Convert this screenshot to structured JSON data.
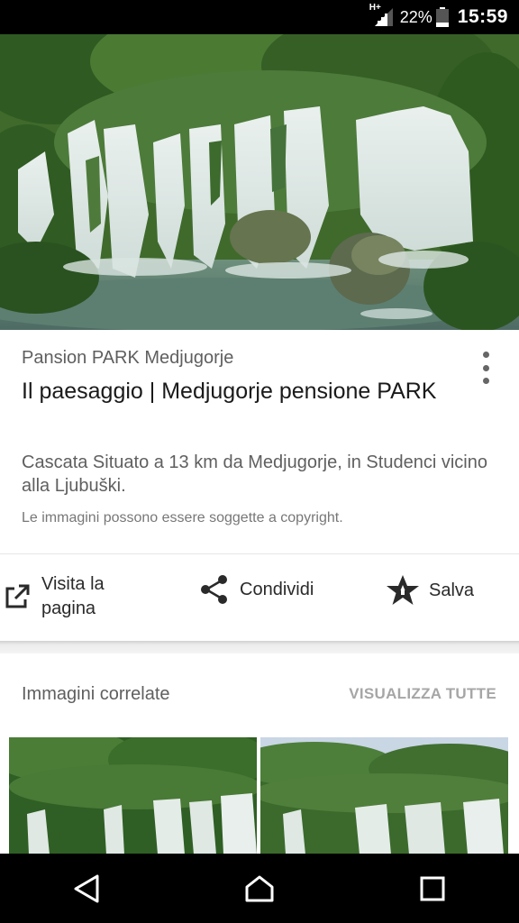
{
  "status_bar": {
    "network": "H+",
    "battery_percent": "22%",
    "battery_level": 0.22,
    "time": "15:59",
    "icons": [
      "signal-icon",
      "battery-icon"
    ]
  },
  "result": {
    "source": "Pansion PARK Medjugorje",
    "title": "Il paesaggio | Medjugorje pensione PARK",
    "description": "Cascata Situato a 13 km da Medjugorje, in Studenci vicino alla Ljubuški.",
    "copyright_note": "Le immagini possono essere soggette a copyright."
  },
  "actions": {
    "visit_line1": "Visita la",
    "visit_line2": "pagina",
    "share": "Condividi",
    "save": "Salva"
  },
  "related": {
    "title": "Immagini correlate",
    "view_all": "VISUALIZZA TUTTE"
  },
  "colors": {
    "status_bar": "#000000",
    "text_primary": "#1a1a1a",
    "text_secondary": "#5f5f5f",
    "link_muted": "#a6a6a6"
  }
}
